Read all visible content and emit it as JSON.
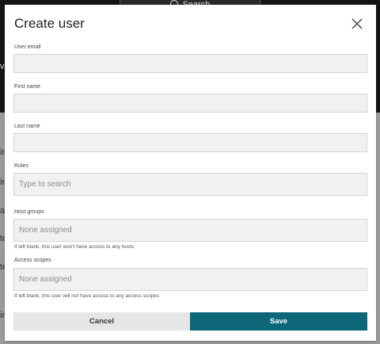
{
  "background": {
    "search_label": "Search",
    "edge_letters": [
      "v",
      "ir",
      "ir",
      "a",
      "te",
      "te",
      "ir"
    ]
  },
  "modal": {
    "title": "Create user",
    "close_icon": "close-icon",
    "fields": {
      "user_email": {
        "label": "User email",
        "value": ""
      },
      "first_name": {
        "label": "First name",
        "value": ""
      },
      "last_name": {
        "label": "Last name",
        "value": ""
      },
      "roles": {
        "label": "Roles",
        "placeholder": "Type to search"
      },
      "host_groups": {
        "label": "Host groups",
        "value": "None assigned",
        "hint": "If left blank, this user won't have access to any hosts"
      },
      "access_scopes": {
        "label": "Access scopes",
        "value": "None assigned",
        "hint": "If left blank, this user will not have access to any access scopes"
      }
    },
    "buttons": {
      "cancel": "Cancel",
      "save": "Save"
    }
  },
  "colors": {
    "primary": "#0d6779",
    "cancel_bg": "#e6e6e6",
    "input_bg": "#f1f1f1",
    "overlay": "#9a9a9a"
  }
}
